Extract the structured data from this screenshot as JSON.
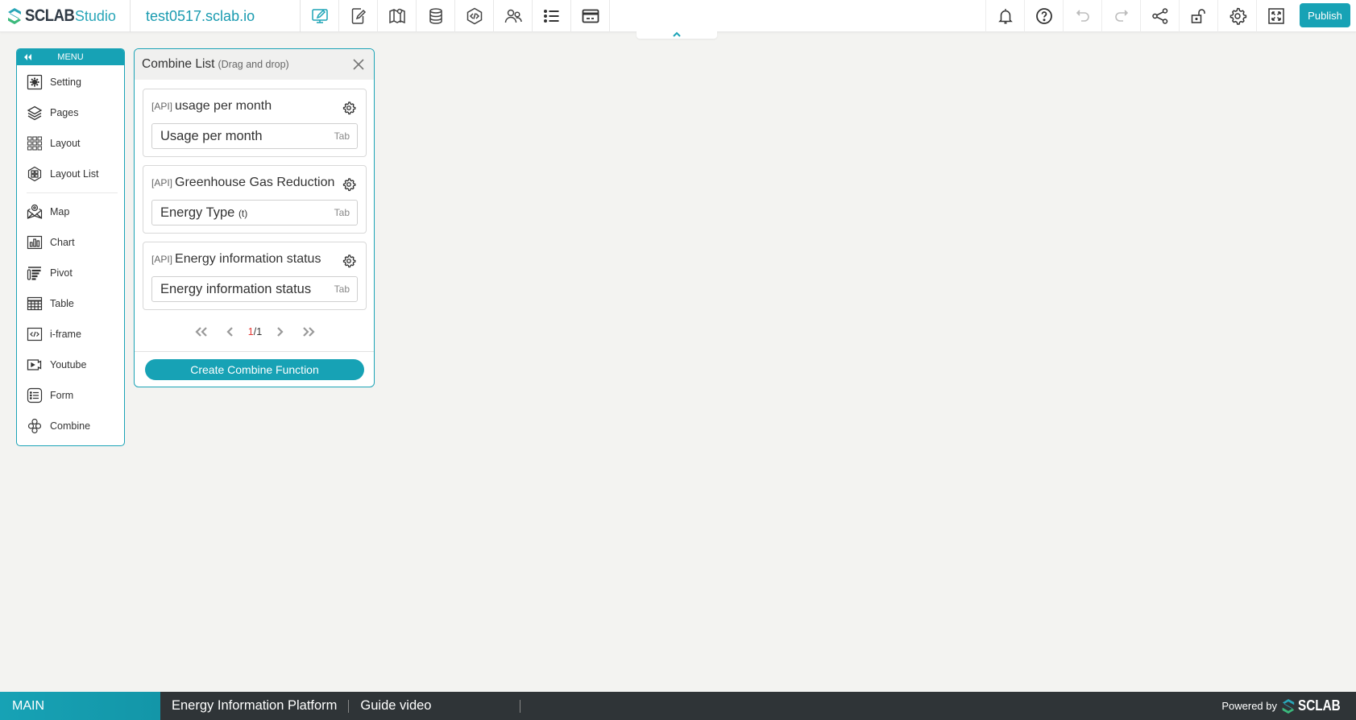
{
  "header": {
    "brand": "SCLAB",
    "product": "Studio",
    "domain": "test0517.sclab.io",
    "tools": [
      {
        "name": "design-editor",
        "icon": "monitor-pen-icon",
        "active": true
      },
      {
        "name": "mobile-editor",
        "icon": "mobile-pen-icon",
        "active": false
      },
      {
        "name": "map",
        "icon": "map-pin-icon",
        "active": false
      },
      {
        "name": "database",
        "icon": "database-icon",
        "active": false
      },
      {
        "name": "code",
        "icon": "code-hexagon-icon",
        "active": false
      },
      {
        "name": "users",
        "icon": "users-icon",
        "active": false
      },
      {
        "name": "list",
        "icon": "list-icon",
        "active": false
      },
      {
        "name": "billing",
        "icon": "credit-card-icon",
        "active": false
      }
    ],
    "right_tools": [
      {
        "name": "notifications",
        "icon": "bell-icon"
      },
      {
        "name": "help",
        "icon": "help-circle-icon"
      },
      {
        "name": "undo",
        "icon": "undo-icon",
        "disabled": true
      },
      {
        "name": "redo",
        "icon": "redo-icon",
        "disabled": true
      },
      {
        "name": "share",
        "icon": "share-icon"
      },
      {
        "name": "lock",
        "icon": "unlock-icon"
      },
      {
        "name": "settings",
        "icon": "gear-icon"
      },
      {
        "name": "fullscreen",
        "icon": "expand-icon"
      }
    ],
    "publish_label": "Publish",
    "accent": "#17a2b5"
  },
  "menu": {
    "title": "MENU",
    "items": [
      {
        "label": "Setting",
        "icon": "gear-box-icon"
      },
      {
        "label": "Pages",
        "icon": "layers-icon"
      },
      {
        "label": "Layout",
        "icon": "grid-icon"
      },
      {
        "label": "Layout List",
        "icon": "layout-list-icon"
      },
      {
        "label": "Map",
        "icon": "map-icon"
      },
      {
        "label": "Chart",
        "icon": "bar-chart-icon"
      },
      {
        "label": "Pivot",
        "icon": "pivot-icon"
      },
      {
        "label": "Table",
        "icon": "table-icon"
      },
      {
        "label": "i-frame",
        "icon": "code-box-icon"
      },
      {
        "label": "Youtube",
        "icon": "video-icon"
      },
      {
        "label": "Form",
        "icon": "form-list-icon"
      },
      {
        "label": "Combine",
        "icon": "combine-icon"
      }
    ]
  },
  "combine_panel": {
    "title": "Combine List",
    "subtitle": "(Drag and drop)",
    "cards": [
      {
        "tag": "[API]",
        "title": "usage per month",
        "value": "Usage per month",
        "value_suffix": "",
        "type": "Tab"
      },
      {
        "tag": "[API]",
        "title": "Greenhouse Gas Reduction",
        "value": "Energy Type",
        "value_suffix": "(t)",
        "type": "Tab"
      },
      {
        "tag": "[API]",
        "title": "Energy information status",
        "value": "Energy information status",
        "value_suffix": "",
        "type": "Tab"
      }
    ],
    "pagination": {
      "current": "1",
      "total": "/1"
    },
    "create_label": "Create Combine Function"
  },
  "footer": {
    "main_label": "MAIN",
    "items": [
      "Energy Information Platform",
      "Guide video"
    ],
    "powered_by": "Powered by",
    "powered_brand": "SCLAB"
  }
}
